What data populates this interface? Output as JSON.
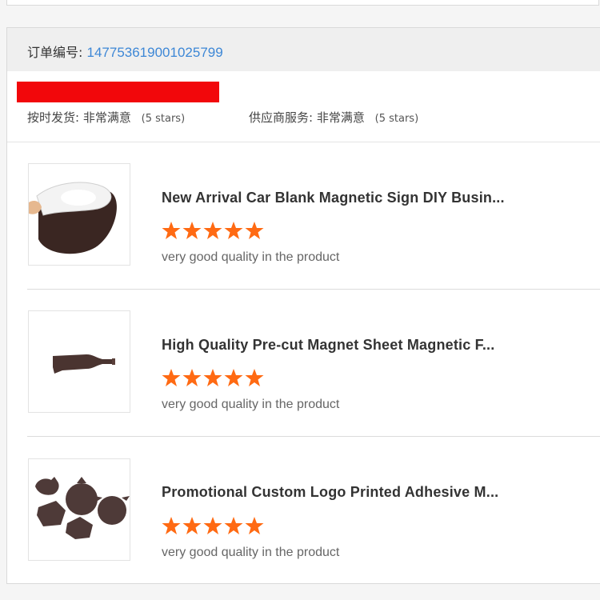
{
  "order": {
    "label": "订单编号:",
    "number": "147753619001025799"
  },
  "ratings": [
    {
      "label": "按时发货:",
      "value": "非常满意",
      "stars_text": "(5 stars)"
    },
    {
      "label": "供应商服务:",
      "value": "非常满意",
      "stars_text": "(5 stars)"
    }
  ],
  "colors": {
    "accent_link": "#3d87d6",
    "star": "#ff6a13",
    "redaction": "#f2070b"
  },
  "items": [
    {
      "title": "New Arrival Car Blank Magnetic Sign DIY Busin...",
      "rating": 5,
      "review": "very good quality in the product",
      "thumbnail_icon": "magnetic-sheet-roll-image"
    },
    {
      "title": "High Quality Pre-cut Magnet Sheet Magnetic F...",
      "rating": 5,
      "review": "very good quality in the product",
      "thumbnail_icon": "bottle-shaped-magnet-image"
    },
    {
      "title": "Promotional Custom Logo Printed Adhesive M...",
      "rating": 5,
      "review": "very good quality in the product",
      "thumbnail_icon": "assorted-shaped-magnets-image"
    }
  ]
}
